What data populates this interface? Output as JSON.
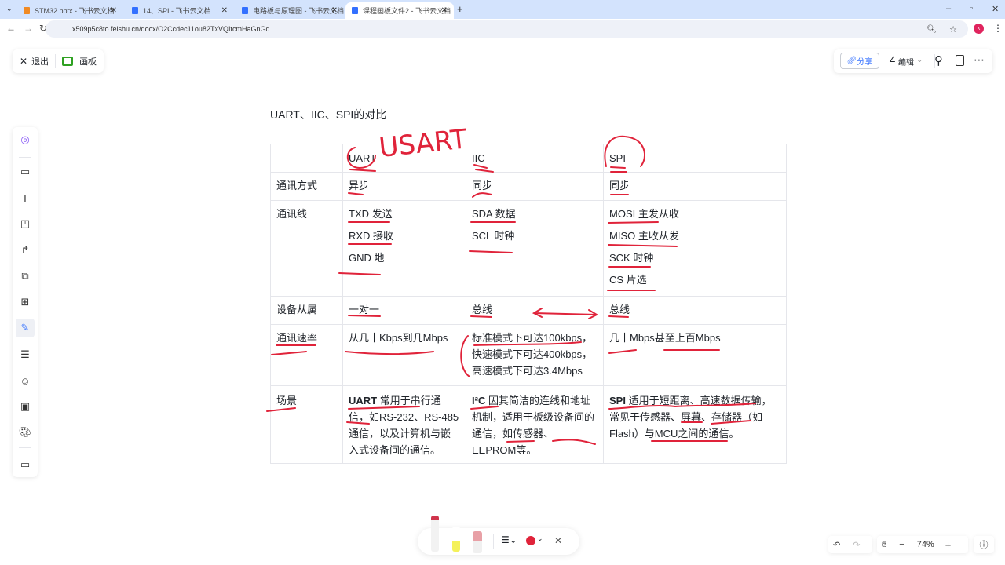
{
  "browser": {
    "tabs": [
      {
        "label": "STM32.pptx - 飞书云文档",
        "color": "#f08a24"
      },
      {
        "label": "14、SPI - 飞书云文档",
        "color": "#3370ff"
      },
      {
        "label": "电路板与原理图 - 飞书云文档",
        "color": "#3370ff"
      },
      {
        "label": "课程画板文件2 - 飞书云文档",
        "color": "#3370ff"
      }
    ],
    "url": "x509p5c8to.feishu.cn/docx/O2Ccdec11ou82TxVQItcmHaGnGd",
    "avatar_letter": "k"
  },
  "toolbar": {
    "exit_label": "退出",
    "board_label": "画板",
    "share_label": "分享",
    "edit_label": "编辑"
  },
  "heading": "UART、IIC、SPI的对比",
  "table": {
    "header": [
      "",
      "UART",
      "IIC",
      "SPI"
    ],
    "rows": [
      {
        "label": "通讯方式",
        "uart": [
          "异步"
        ],
        "iic": [
          "同步"
        ],
        "spi": [
          "同步"
        ]
      },
      {
        "label": "通讯线",
        "uart": [
          "TXD 发送",
          "RXD 接收",
          "GND 地"
        ],
        "iic": [
          "SDA 数据",
          "SCL 时钟"
        ],
        "spi": [
          "MOSI 主发从收",
          "MISO 主收从发",
          "SCK 时钟",
          "CS 片选"
        ]
      },
      {
        "label": "设备从属",
        "uart": [
          "一对一"
        ],
        "iic": [
          "总线"
        ],
        "spi": [
          "总线"
        ]
      },
      {
        "label": "通讯速率",
        "uart": [
          "从几十Kbps到几Mbps"
        ],
        "iic": [
          "标准模式下可达100kbps，",
          "快速模式下可达400kbps，",
          "高速模式下可达3.4Mbps"
        ],
        "spi": [
          "几十Mbps甚至上百Mbps"
        ]
      }
    ],
    "scene": {
      "label": "场景",
      "uart": {
        "bold": "UART",
        "text": " 常用于串行通信，如RS-232、RS-485通信，以及计算机与嵌入式设备间的通信。"
      },
      "iic": {
        "bold": "I²C",
        "text": " 因其简洁的连线和地址机制，适用于板级设备间的通信，如传感器、EEPROM等。"
      },
      "spi": {
        "bold": "SPI",
        "text": " 适用于短距离、高速数据传输，常见于传感器、屏幕、存储器（如Flash）与MCU之间的通信。"
      }
    }
  },
  "annotation_text": "USART",
  "ink_color": "#e0233a",
  "zoom": {
    "level": "74%"
  }
}
